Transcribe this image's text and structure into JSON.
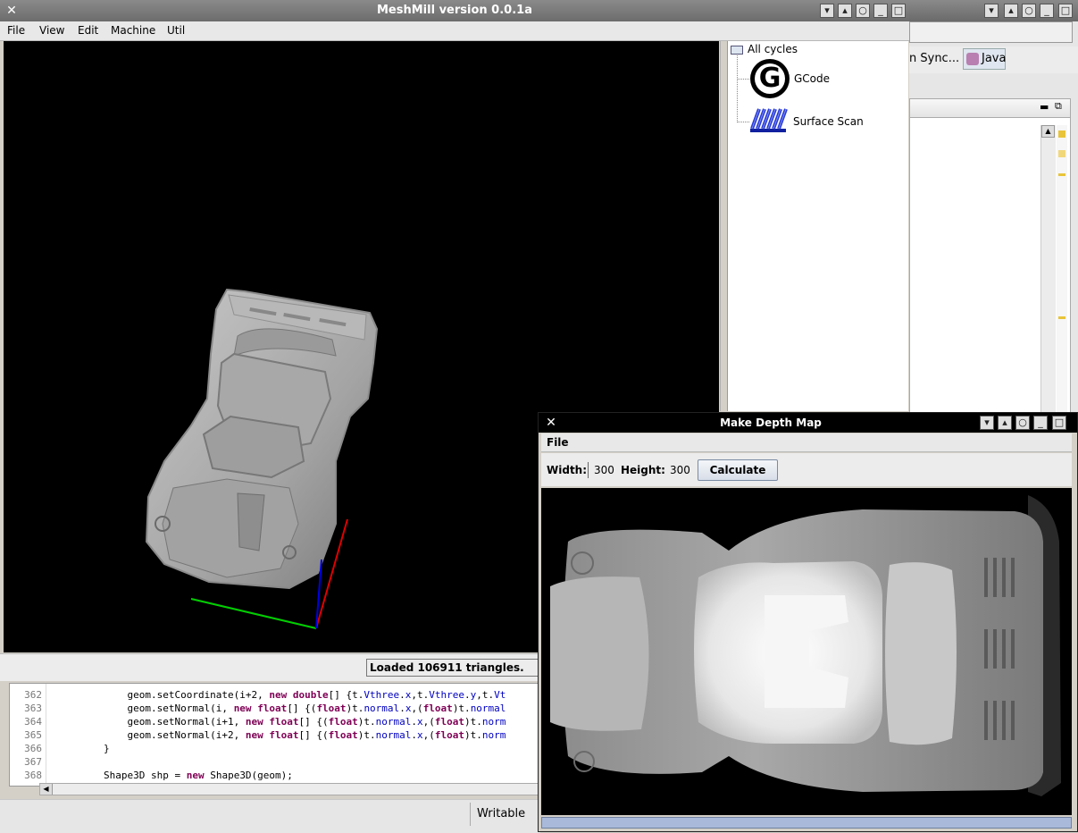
{
  "meshmill": {
    "title": "MeshMill version 0.0.1a",
    "menu": [
      "File",
      "View",
      "Edit",
      "Machine",
      "Util"
    ],
    "tree": {
      "root": "All cycles",
      "items": [
        "GCode",
        "Surface Scan"
      ]
    },
    "status": "Loaded 106911 triangles."
  },
  "editor": {
    "line_numbers": [
      "362",
      "363",
      "364",
      "365",
      "366",
      "367",
      "368"
    ],
    "writable": "Writable"
  },
  "depth_map": {
    "title": "Make Depth Map",
    "menu_file": "File",
    "width_label": "Width:",
    "width_value": "300",
    "height_label": "Height:",
    "height_value": "300",
    "calculate_label": "Calculate"
  },
  "background_window": {
    "perspective_sync": "n Sync...",
    "perspective_java": "Java"
  },
  "colors": {
    "axis_x": "#00d000",
    "axis_y": "#e00000",
    "axis_z": "#0000e0",
    "progress": "#a9b9d9"
  },
  "icons": [
    "close-icon",
    "chevron-down-icon",
    "chevron-up-icon",
    "restore-icon",
    "minimize-icon",
    "maximize-icon",
    "folder-icon",
    "gcode-icon",
    "surface-scan-icon"
  ]
}
